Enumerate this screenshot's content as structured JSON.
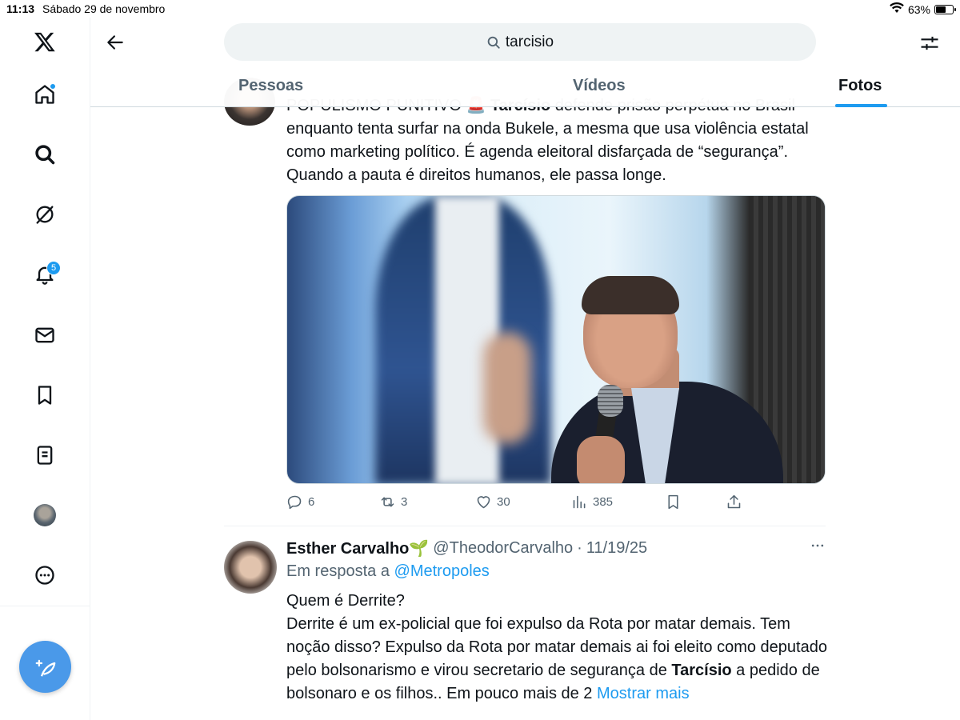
{
  "status_bar": {
    "time": "11:13",
    "date": "Sábado 29 de novembro",
    "battery": "63%",
    "battery_level": 0.63
  },
  "sidebar": {
    "items": [
      {
        "name": "home",
        "badge": ""
      },
      {
        "name": "explore",
        "badge": ""
      },
      {
        "name": "grok",
        "badge": ""
      },
      {
        "name": "notifications",
        "badge": "5"
      },
      {
        "name": "messages",
        "badge": ""
      },
      {
        "name": "bookmarks",
        "badge": ""
      },
      {
        "name": "lists",
        "badge": ""
      },
      {
        "name": "profile",
        "badge": ""
      },
      {
        "name": "more",
        "badge": ""
      }
    ]
  },
  "header": {
    "search_query": "tarcisio",
    "tabs": [
      {
        "label": "Pessoas",
        "active": false
      },
      {
        "label": "Vídeos",
        "active": false
      },
      {
        "label": "Fotos",
        "active": true
      }
    ]
  },
  "tweet1": {
    "text_line1_pre": "POPULISMO PUNITIVO 🚨 ",
    "text_line1_bold": "Tarcísio",
    "text_line1_post": " defende prisão perpétua no Brasil",
    "text_rest": "enquanto tenta surfar na onda Bukele, a mesma que usa violência estatal como marketing político. É agenda eleitoral disfarçada de “segurança”. Quando a pauta é direitos humanos, ele passa longe.",
    "stats": {
      "replies": "6",
      "reposts": "3",
      "likes": "30",
      "views": "385"
    }
  },
  "tweet2": {
    "name": "Esther Carvalho🌱",
    "handle": "@TheodorCarvalho",
    "separator": "·",
    "date": "11/19/25",
    "reply_prefix": "Em resposta a ",
    "reply_to": "@Metropoles",
    "text_pre": "Quem é Derrite?\nDerrite é um ex-policial que foi expulso da Rota por matar demais. Tem noção disso? Expulso da Rota por matar demais ai foi eleito como deputado pelo bolsonarismo e virou secretario de segurança de ",
    "text_bold": "Tarcísio",
    "text_post": " a pedido de bolsonaro e os filhos.. Em pouco mais de 2 ",
    "show_more": "Mostrar mais"
  },
  "colors": {
    "accent": "#1d9bf0",
    "text": "#0f1419",
    "muted": "#536471"
  }
}
